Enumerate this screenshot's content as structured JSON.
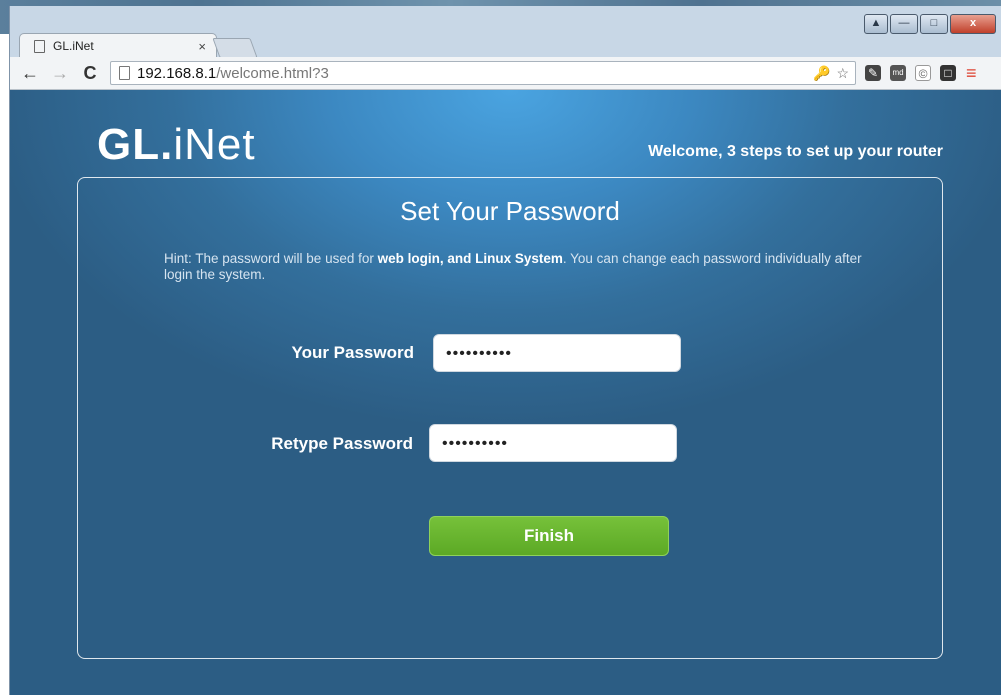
{
  "browser": {
    "tab_title": "GL.iNet",
    "tab_close": "×",
    "url_host": "192.168.8.1",
    "url_path": "/welcome.html?3"
  },
  "page": {
    "logo_gl": "GL.",
    "logo_net": "iNet",
    "tagline": "Welcome, 3 steps to set up your router",
    "title": "Set Your Password",
    "hint_prefix": "Hint: The password will be used for ",
    "hint_bold": "web login, and Linux System",
    "hint_suffix": ". You can change each password individually after login the system.",
    "password_label": "Your Password",
    "password_value": "••••••••••",
    "retype_label": "Retype Password",
    "retype_value": "••••••••••",
    "finish_label": "Finish"
  },
  "colors": {
    "finish_green": "#6bb82f",
    "background_blue": "#3c88c1"
  }
}
